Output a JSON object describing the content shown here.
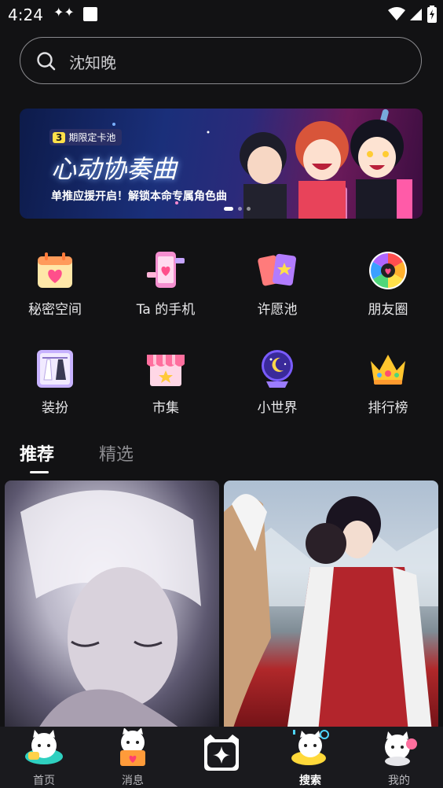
{
  "status_bar": {
    "time": "4:24",
    "sparkle_icon": "sparkle-icon",
    "notification_icon": "square-notification-icon"
  },
  "search": {
    "placeholder": "沈知晚"
  },
  "banner": {
    "tag_number": "3",
    "tag_text": "期限定卡池",
    "title": "心动协奏曲",
    "subtitle": "单推应援开启！解锁本命专属角色曲"
  },
  "features": [
    {
      "label": "秘密空间",
      "icon": "calendar-heart-icon"
    },
    {
      "label": "Ta 的手机",
      "icon": "phone-heart-icon"
    },
    {
      "label": "许愿池",
      "icon": "wish-cards-icon"
    },
    {
      "label": "朋友圈",
      "icon": "moments-wheel-icon"
    },
    {
      "label": "装扮",
      "icon": "wardrobe-icon"
    },
    {
      "label": "市集",
      "icon": "market-stall-icon"
    },
    {
      "label": "小世界",
      "icon": "crystal-ball-icon"
    },
    {
      "label": "排行榜",
      "icon": "crown-icon"
    }
  ],
  "tabs": {
    "recommend": "推荐",
    "featured": "精选"
  },
  "bottom_nav": [
    {
      "label": "首页",
      "icon": "home-cat-icon"
    },
    {
      "label": "消息",
      "icon": "message-cat-icon"
    },
    {
      "label": "",
      "icon": "create-plus-icon"
    },
    {
      "label": "搜索",
      "icon": "search-cat-icon"
    },
    {
      "label": "我的",
      "icon": "profile-cat-icon"
    }
  ],
  "colors": {
    "background": "#121214",
    "accent_pink": "#ff6fa6",
    "nav_bg": "#1a1a1e"
  }
}
